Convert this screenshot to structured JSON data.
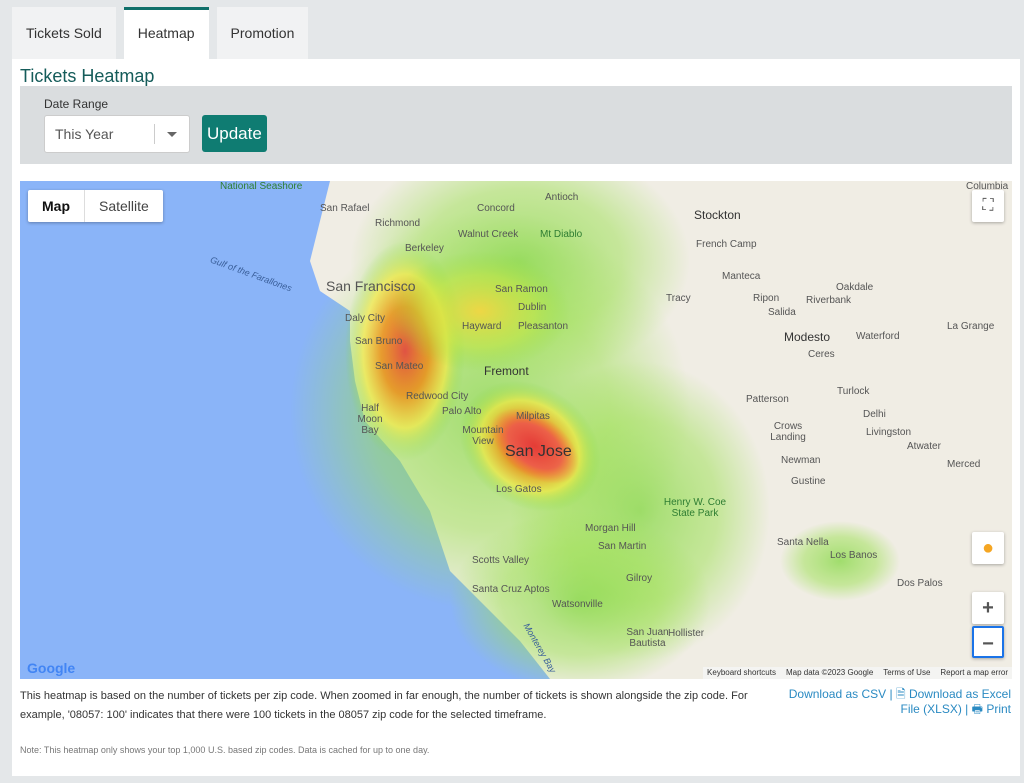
{
  "tabs": [
    {
      "label": "Tickets Sold"
    },
    {
      "label": "Heatmap",
      "active": true
    },
    {
      "label": "Promotion"
    }
  ],
  "title": "Tickets Heatmap",
  "filter": {
    "label": "Date Range",
    "value": "This Year",
    "button": "Update"
  },
  "map": {
    "type_buttons": [
      "Map",
      "Satellite"
    ],
    "labels": {
      "sf": "San Francisco",
      "sj": "San Jose",
      "fremont": "Fremont",
      "stockton": "Stockton",
      "modesto": "Modesto",
      "oakland": "Walnut Creek",
      "concord": "Concord",
      "antioch": "Antioch",
      "diablo": "Mt Diablo",
      "richmond": "Richmond",
      "berkeley": "Berkeley",
      "sanrafael": "San Rafael",
      "seashore": "National Seashore",
      "gulf": "Gulf of the Farallones",
      "daly": "Daly City",
      "sanbruno": "San Bruno",
      "sanmateo": "San Mateo",
      "redwood": "Redwood City",
      "half": "Half Moon Bay",
      "paloalto": "Palo Alto",
      "mtview": "Mountain View",
      "milpitas": "Milpitas",
      "losgatos": "Los Gatos",
      "hayward": "Hayward",
      "pleasanton": "Pleasanton",
      "dublin": "Dublin",
      "sanramon": "San Ramon",
      "tracy": "Tracy",
      "manteca": "Manteca",
      "frenchcamp": "French Camp",
      "ripon": "Ripon",
      "salida": "Salida",
      "riverbank": "Riverbank",
      "oakdale": "Oakdale",
      "waterford": "Waterford",
      "ceres": "Ceres",
      "lagrange": "La Grange",
      "turlock": "Turlock",
      "patterson": "Patterson",
      "crows": "Crows Landing",
      "delhi": "Delhi",
      "livingston": "Livingston",
      "atwater": "Atwater",
      "merced": "Merced",
      "newman": "Newman",
      "gustine": "Gustine",
      "santanella": "Santa Nella",
      "losbanos": "Los Banos",
      "dospalos": "Dos Palos",
      "coe": "Henry W. Coe State Park",
      "morganhill": "Morgan Hill",
      "sanmartin": "San Martin",
      "gilroy": "Gilroy",
      "scotts": "Scotts Valley",
      "santacruz": "Santa Cruz",
      "aptos": "Aptos",
      "watsonville": "Watsonville",
      "sjb": "San Juan Bautista",
      "hollister": "Hollister",
      "monterey": "Monterey Bay",
      "columbia": "Columbia"
    },
    "attribution": [
      "Keyboard shortcuts",
      "Map data ©2023 Google",
      "Terms of Use",
      "Report a map error"
    ],
    "logo": "Google",
    "zoom_in": "+",
    "zoom_out": "−"
  },
  "description": "This heatmap is based on the number of tickets per zip code. When zoomed in far enough, the number of tickets is shown alongside the zip code. For example, '08057: 100' indicates that there were 100 tickets in the 08057 zip code for the selected timeframe.",
  "downloads": {
    "csv": "Download as CSV",
    "sep": " | ",
    "excel": "Download as Excel File (XLSX)",
    "print": "Print"
  },
  "note": "Note: This heatmap only shows your top 1,000 U.S. based zip codes. Data is cached for up to one day.",
  "colors": {
    "accent": "#0f7c72",
    "link": "#2a8ac2",
    "ocean": "#8ab4f8"
  }
}
